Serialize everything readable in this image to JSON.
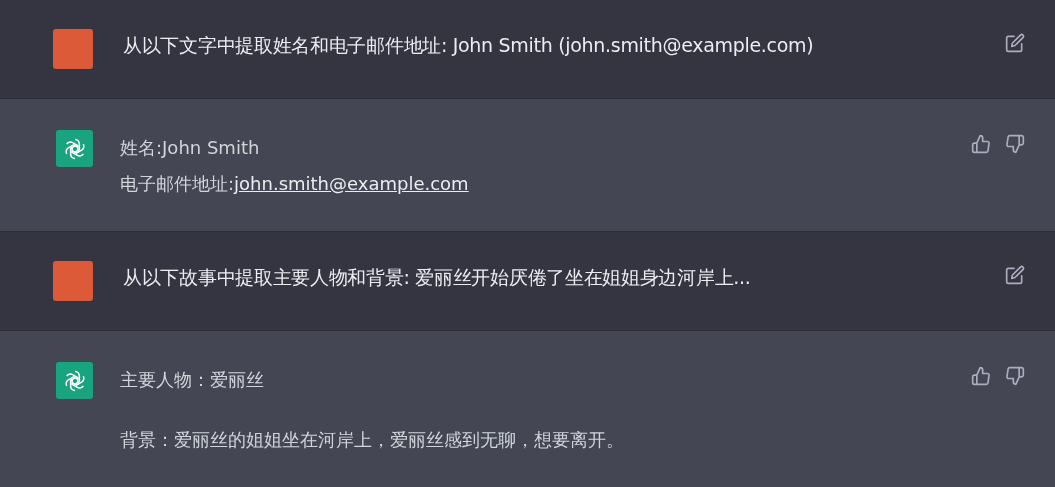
{
  "messages": [
    {
      "kind": "user",
      "text": "从以下文字中提取姓名和电子邮件地址: John Smith (john.smith@example.com)"
    },
    {
      "kind": "assistant",
      "paragraphs": [
        [
          {
            "text": "姓名:John Smith"
          },
          {
            "text": "电子邮件地址:",
            "link": "john.smith@example.com"
          }
        ]
      ]
    },
    {
      "kind": "user",
      "text": "从以下故事中提取主要人物和背景: 爱丽丝开始厌倦了坐在姐姐身边河岸上..."
    },
    {
      "kind": "assistant",
      "paragraphs": [
        [
          {
            "text": "主要人物：爱丽丝"
          }
        ],
        [
          {
            "text": "背景：爱丽丝的姐姐坐在河岸上，爱丽丝感到无聊，想要离开。"
          }
        ]
      ]
    }
  ]
}
